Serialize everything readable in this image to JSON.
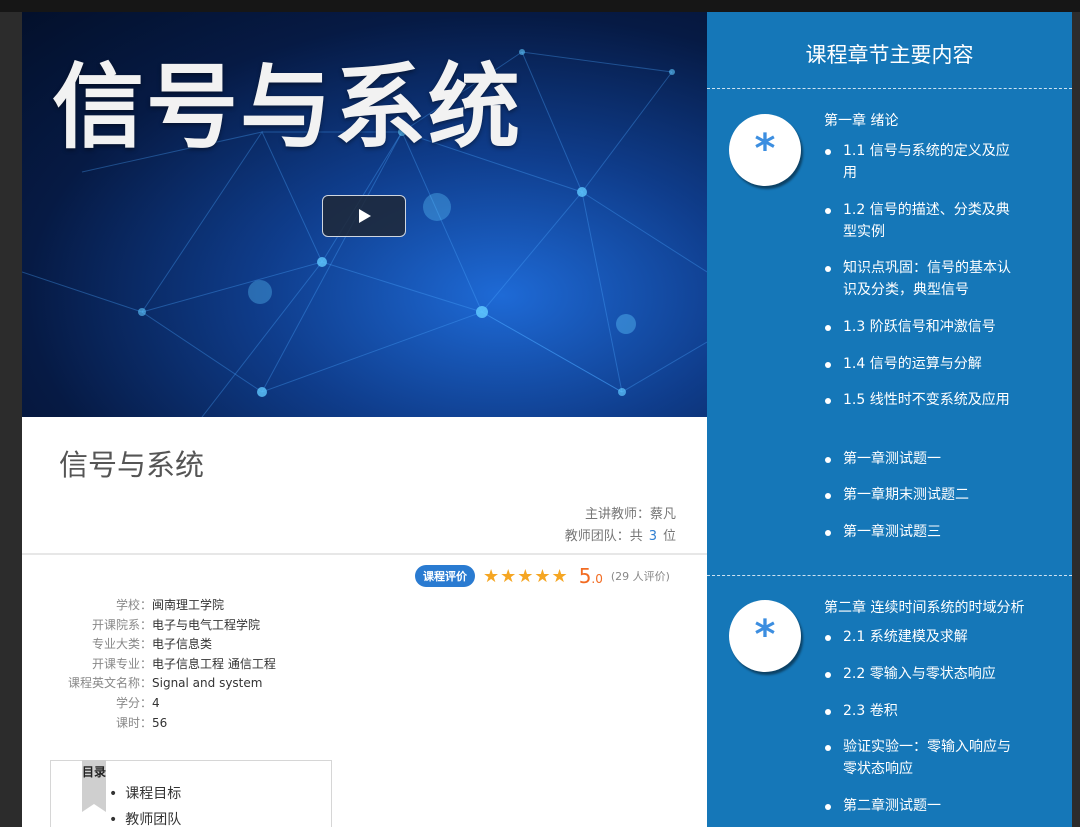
{
  "video": {
    "banner_text": "信号与系统",
    "play_label": "▶"
  },
  "course": {
    "title": "信号与系统",
    "lead_teacher": "主讲教师：蔡凡",
    "team_prefix": "教师团队：共",
    "team_count": "3",
    "team_suffix": "位"
  },
  "rating": {
    "badge": "课程评价",
    "stars": "★★★★★",
    "score": "5",
    "score_decimal": ".0",
    "count": "(29 人评价)",
    "star_color": "#f5a623"
  },
  "info": [
    {
      "label": "学校：",
      "value": "闽南理工学院"
    },
    {
      "label": "开课院系：",
      "value": "电子与电气工程学院"
    },
    {
      "label": "专业大类：",
      "value": "电子信息类"
    },
    {
      "label": "开课专业：",
      "value": "电子信息工程 通信工程"
    },
    {
      "label": "课程英文名称：",
      "value": "Signal and system"
    },
    {
      "label": "学分：",
      "value": "4"
    },
    {
      "label": "课时：",
      "value": "56"
    }
  ],
  "toc": {
    "ribbon": "目录",
    "items": [
      "课程目标",
      "教师团队"
    ]
  },
  "panel": {
    "title": "课程章节主要内容",
    "background": "#1577b8",
    "chapters": [
      {
        "icon": "*",
        "title": "第一章 绪论",
        "items": [
          "1.1 信号与系统的定义及应用",
          "1.2 信号的描述、分类及典型实例",
          "知识点巩固：信号的基本认识及分类，典型信号",
          "1.3 阶跃信号和冲激信号",
          "1.4 信号的运算与分解",
          "1.5 线性时不变系统及应用",
          "第一章测试题一",
          "第一章期末测试题二",
          "第一章测试题三"
        ]
      },
      {
        "icon": "*",
        "title": "第二章 连续时间系统的时域分析",
        "items": [
          "2.1 系统建模及求解",
          "2.2 零输入与零状态响应",
          "2.3 卷积",
          "验证实验一：零输入响应与零状态响应",
          "第二章测试题一"
        ]
      }
    ]
  }
}
